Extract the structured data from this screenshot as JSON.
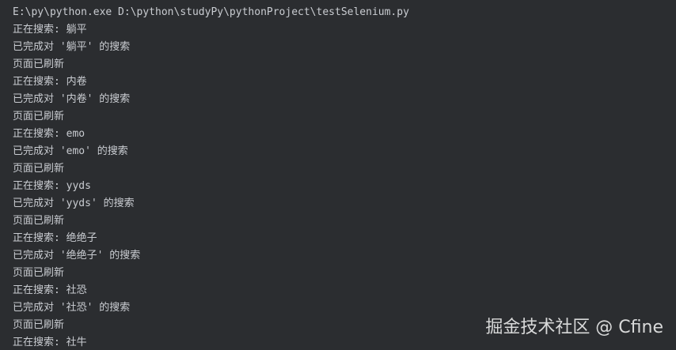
{
  "console": {
    "lines": [
      "E:\\py\\python.exe D:\\python\\studyPy\\pythonProject\\testSelenium.py",
      "正在搜索: 躺平",
      "已完成对 '躺平' 的搜索",
      "页面已刷新",
      "正在搜索: 内卷",
      "已完成对 '内卷' 的搜索",
      "页面已刷新",
      "正在搜索: emo",
      "已完成对 'emo' 的搜索",
      "页面已刷新",
      "正在搜索: yyds",
      "已完成对 'yyds' 的搜索",
      "页面已刷新",
      "正在搜索: 绝绝子",
      "已完成对 '绝绝子' 的搜索",
      "页面已刷新",
      "正在搜索: 社恐",
      "已完成对 '社恐' 的搜索",
      "页面已刷新",
      "正在搜索: 社牛"
    ]
  },
  "watermark": {
    "text": "掘金技术社区 @ Cfine"
  }
}
